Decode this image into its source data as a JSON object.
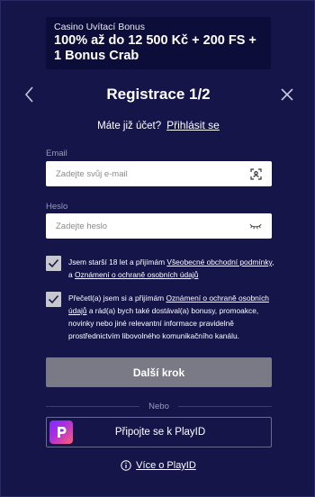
{
  "promo": {
    "subtitle": "Casino Uvítací Bonus",
    "title": "100% až do 12 500 Kč + 200 FS + 1 Bonus Crab"
  },
  "header": {
    "title": "Registrace 1/2"
  },
  "login": {
    "question": "Máte již účet?",
    "link": "Přihlásit se"
  },
  "email": {
    "label": "Email",
    "placeholder": "Zadejte svůj e-mail",
    "value": ""
  },
  "password": {
    "label": "Heslo",
    "placeholder": "Zadejte heslo",
    "value": ""
  },
  "consents": [
    {
      "checked": true,
      "text_1": "Jsem starší 18 let a přijímám ",
      "link_1": "Všeobecné obchodní podmínky",
      "text_2": ", a ",
      "link_2": "Oznámení o ochraně osobních údajů"
    },
    {
      "checked": true,
      "text_1": "Přečetl(a) jsem si a přijímám ",
      "link_1": "Oznámení o ochraně osobních údajů",
      "text_2": " a rád(a) bych také dostával(a) bonusy, promoakce, novinky nebo jiné relevantní informace pravidelně prostřednictvím libovolného komunikačního kanálu."
    }
  ],
  "buttons": {
    "next": "Další krok",
    "divider": "Nebo",
    "playid": "Připojte se k PlayID"
  },
  "more": {
    "link": "Více o PlayID"
  },
  "colors": {
    "background": "#15154a",
    "promo_background": "#0d0d3a",
    "button_disabled": "#7a7a86",
    "checkbox": "#c7c7cf",
    "muted_text": "#9a9ab8"
  },
  "icons": {
    "back": "chevron-left-icon",
    "close": "close-icon",
    "email_field": "scan-face-icon",
    "password_field": "eye-closed-icon",
    "checkbox": "checkmark-icon",
    "playid": "playid-logo-icon",
    "info": "info-icon"
  }
}
